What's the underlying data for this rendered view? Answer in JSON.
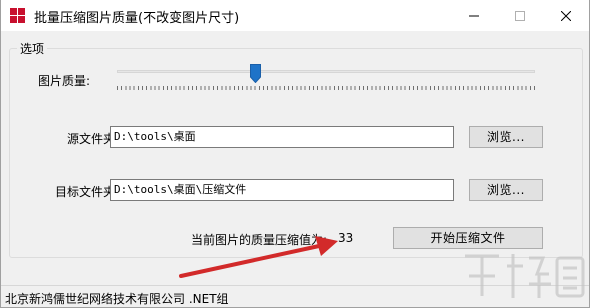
{
  "window": {
    "title": "批量压缩图片质量(不改变图片尺寸)"
  },
  "options": {
    "group_title": "选项",
    "quality_label": "图片质量:",
    "quality_value": 33,
    "source_label": "源文件夹:",
    "source_value": "D:\\tools\\桌面",
    "target_label": "目标文件夹:",
    "target_value": "D:\\tools\\桌面\\压缩文件",
    "browse_label": "浏览...",
    "current_label": "当前图片的质量压缩值为:",
    "current_value": "33",
    "start_label": "开始压缩文件"
  },
  "status": {
    "text": "北京新鸿儒世纪网络技术有限公司 .NET组"
  },
  "colors": {
    "arrow": "#d22a2a",
    "slider_thumb": "#1e73c8",
    "app_icon": "#c8102e"
  }
}
